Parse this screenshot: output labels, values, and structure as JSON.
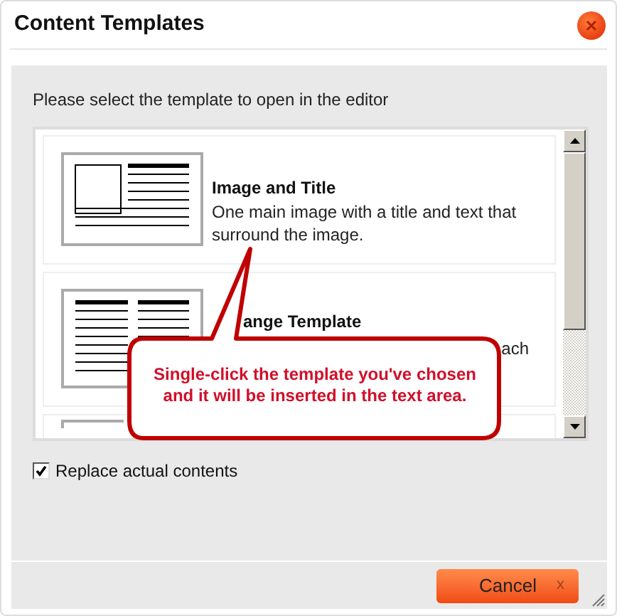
{
  "window": {
    "title": "Content Templates"
  },
  "instruction": "Please select the template to open in the editor",
  "templates": [
    {
      "kind": "image-text",
      "title": "Image and Title",
      "description": "One main image with a title and text that surround the image."
    },
    {
      "kind": "two-column",
      "title": "ange Template",
      "description": "ach"
    },
    {
      "kind": "partial"
    }
  ],
  "callout": "Single-click the template you've chosen and it will be inserted in the text area.",
  "replace_option": {
    "label": "Replace actual contents",
    "checked": true
  },
  "buttons": [
    {
      "label": "Cancel",
      "close_mark": "x"
    }
  ]
}
